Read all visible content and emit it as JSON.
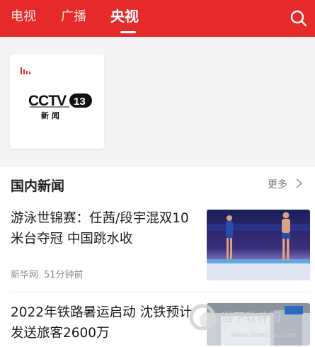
{
  "tabs": [
    {
      "label": "电视"
    },
    {
      "label": "广播"
    },
    {
      "label": "央视",
      "active": true
    }
  ],
  "colors": {
    "brand": "#e62a2a",
    "text": "#1c1c1c",
    "muted": "#888888"
  },
  "channel": {
    "logo_text": "CCTV",
    "logo_number": "13",
    "logo_sub": "新 闻",
    "live_icon": "live-bars-icon"
  },
  "news": {
    "section_title": "国内新闻",
    "more_label": "更多",
    "items": [
      {
        "title": "游泳世锦赛：任茜/段宇混双10米台夺冠 中国跳水收",
        "source": "新华网",
        "time": "51分钟前"
      },
      {
        "title": "2022年铁路暑运启动 沈铁预计发送旅客2600万"
      }
    ]
  },
  "watermark": {
    "name": "当下软件园",
    "url": "www.downxia.com"
  }
}
